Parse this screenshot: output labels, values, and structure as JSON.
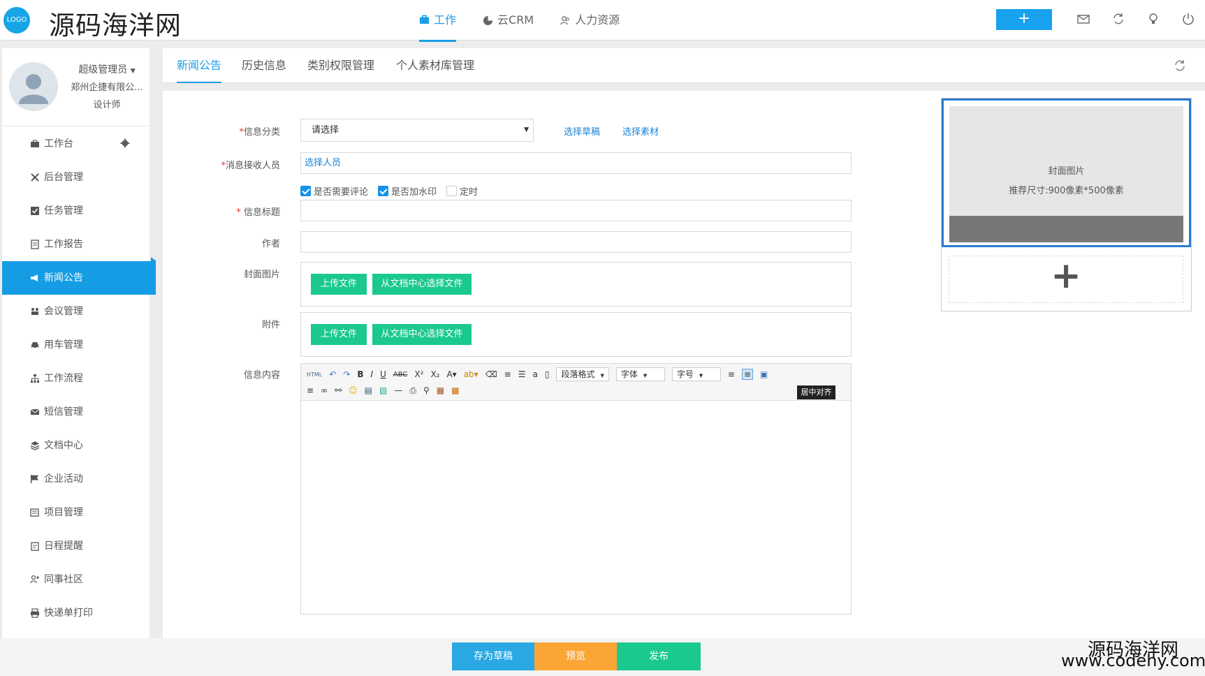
{
  "header": {
    "logo_text": "LOGO",
    "site_name": "源码海洋网",
    "nav": [
      {
        "label": "工作"
      },
      {
        "label": "云CRM"
      },
      {
        "label": "人力资源"
      }
    ],
    "add_label": "+"
  },
  "user": {
    "name": "超级管理员",
    "company": "郑州企捷有限公...",
    "role": "设计师"
  },
  "sidebar": {
    "items": [
      {
        "label": "工作台"
      },
      {
        "label": "后台管理"
      },
      {
        "label": "任务管理"
      },
      {
        "label": "工作报告"
      },
      {
        "label": "新闻公告"
      },
      {
        "label": "会议管理"
      },
      {
        "label": "用车管理"
      },
      {
        "label": "工作流程"
      },
      {
        "label": "短信管理"
      },
      {
        "label": "文档中心"
      },
      {
        "label": "企业活动"
      },
      {
        "label": "项目管理"
      },
      {
        "label": "日程提醒"
      },
      {
        "label": "同事社区"
      },
      {
        "label": "快递单打印"
      }
    ]
  },
  "tabs": [
    {
      "label": "新闻公告"
    },
    {
      "label": "历史信息"
    },
    {
      "label": "类别权限管理"
    },
    {
      "label": "个人素材库管理"
    }
  ],
  "form": {
    "category_label": "信息分类",
    "category_value": "请选择",
    "choose_draft": "选择草稿",
    "choose_material": "选择素材",
    "receiver_label": "消息接收人员",
    "receiver_value": "选择人员",
    "check_comment": "是否需要评论",
    "check_watermark": "是否加水印",
    "check_timing": "定时",
    "title_label": "信息标题",
    "author_label": "作者",
    "cover_label": "封面图片",
    "attach_label": "附件",
    "upload": "上传文件",
    "from_doc": "从文档中心选择文件",
    "content_label": "信息内容",
    "required_mark": "*"
  },
  "editor": {
    "paragraph_format": "段落格式",
    "font": "字体",
    "font_size": "字号",
    "tooltip": "居中对齐"
  },
  "cover": {
    "title": "封面图片",
    "hint": "推荐尺寸:900像素*500像素",
    "add": "+"
  },
  "actions": {
    "save_draft": "存为草稿",
    "preview": "预览",
    "publish": "发布",
    "save_draft_color": "#2aa8e3",
    "preview_color": "#fba634",
    "publish_color": "#1bc98e"
  },
  "watermark": {
    "line1": "源码海洋网",
    "line2": "www.codehy.com"
  }
}
